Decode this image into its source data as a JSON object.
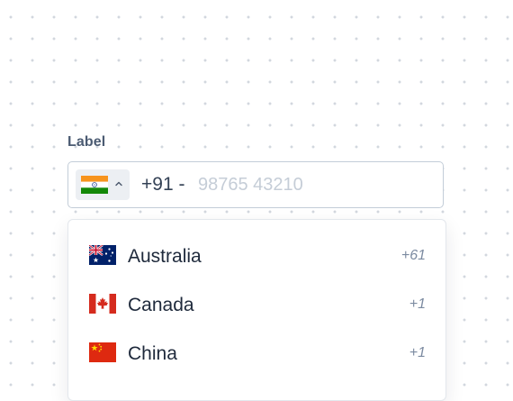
{
  "label": "Label",
  "phone": {
    "selected_country": "India",
    "selected_flag": "india-flag",
    "dial_prefix": "+91 -",
    "value": "",
    "placeholder": "98765 43210"
  },
  "dropdown": {
    "options": [
      {
        "name": "Australia",
        "code": "+61",
        "flag": "australia-flag"
      },
      {
        "name": "Canada",
        "code": "+1",
        "flag": "canada-flag"
      },
      {
        "name": "China",
        "code": "+1",
        "flag": "china-flag"
      }
    ]
  },
  "colors": {
    "label": "#4b5b72",
    "border": "#c3cdd8",
    "placeholder": "#c5cdd7",
    "dial_code": "#7c8ba1",
    "trigger_bg": "#eceff3"
  }
}
